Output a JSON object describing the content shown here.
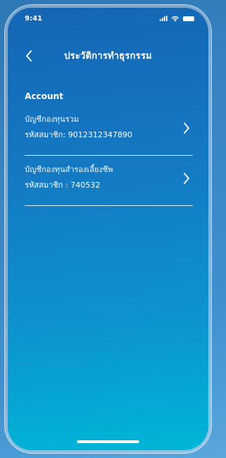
{
  "status_bar": {
    "time": "9:41"
  },
  "nav": {
    "title": "ประวัติการทำธุรกรรม"
  },
  "section": {
    "title": "Account"
  },
  "accounts": [
    {
      "name": "บัญชีกองทุนรวม",
      "member_id": "รหัสสมาชิก: 9012312347890"
    },
    {
      "name": "บัญชีกองทุนสำรองเลี้ยงชีพ",
      "member_id": "รหัสสมาชิก : 740532"
    }
  ],
  "icons": {
    "back": "chevron-left-icon",
    "row_action": "chevron-right-icon",
    "signal": "cellular-signal-icon",
    "wifi": "wifi-icon",
    "battery": "battery-icon"
  },
  "colors": {
    "screen_top": "#1566b5",
    "screen_bottom": "#00b6d6",
    "text": "#ffffff"
  }
}
